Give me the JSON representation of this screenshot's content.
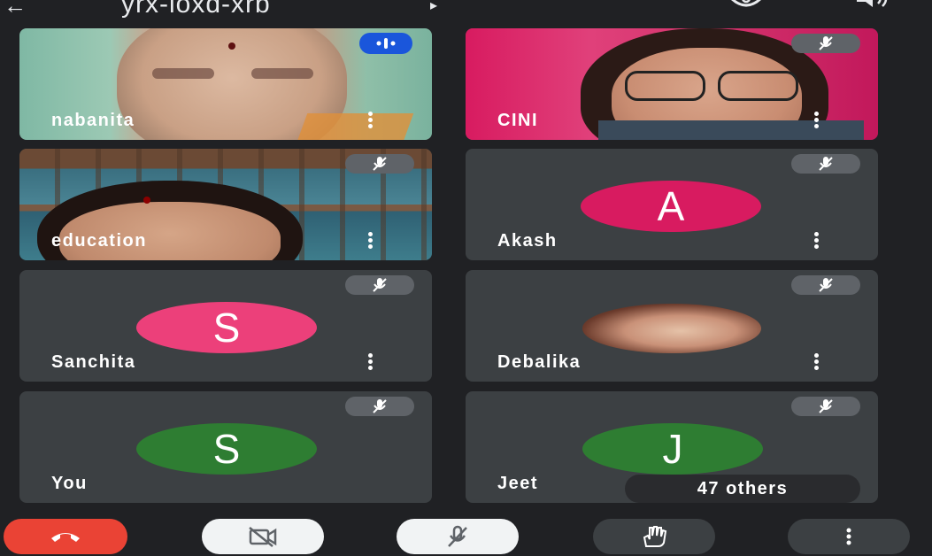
{
  "meeting": {
    "code": "yrx-ioxd-xrb",
    "code_caret": "▸"
  },
  "top_actions": {
    "back": "←"
  },
  "participants": [
    {
      "name": "nabanita",
      "speaking": true
    },
    {
      "name": "CINI",
      "muted": true
    },
    {
      "name": "education",
      "muted": true
    },
    {
      "name": "Akash",
      "initial": "A",
      "color": "#d81b60",
      "muted": true
    },
    {
      "name": "Sanchita",
      "initial": "S",
      "color": "#ec407a",
      "muted": true
    },
    {
      "name": "Debalika",
      "muted": true
    },
    {
      "name": "You",
      "initial": "S",
      "color": "#2e7d32",
      "muted": true
    },
    {
      "name": "Jeet",
      "initial": "J",
      "color": "#2e7d32",
      "muted": true
    }
  ],
  "others_chip": "47 others",
  "controls": {
    "end_call_color": "#ea4335",
    "camera": "camera-off",
    "mic": "mic-off",
    "hand": "raise-hand",
    "more": "more-options"
  }
}
